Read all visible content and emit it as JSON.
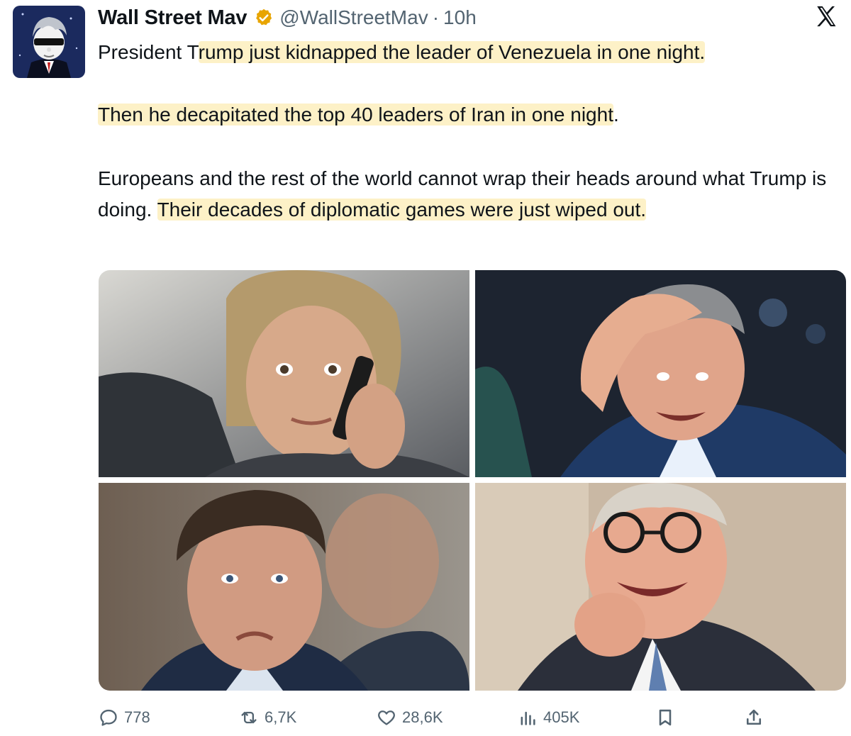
{
  "tweet": {
    "display_name": "Wall Street Mav",
    "handle": "@WallStreetMav",
    "separator": "·",
    "time": "10h",
    "paragraph1": {
      "pre": "President T",
      "highlight": "rump just kidnapped the leader of Venezuela in one night."
    },
    "paragraph2": {
      "highlight": "Then he decapitated the top 40 leaders of Iran in one night",
      "post": "."
    },
    "paragraph3": {
      "pre": "Europeans and the rest of the world cannot wrap their heads around what Trump is doing. ",
      "highlight": "Their decades of diplomatic games were just wiped out."
    },
    "images": [
      {
        "icon": "photo-woman-on-phone"
      },
      {
        "icon": "photo-man-hand-on-forehead"
      },
      {
        "icon": "photo-man-frowning"
      },
      {
        "icon": "photo-man-crying-glasses"
      }
    ]
  },
  "actions": {
    "replies": "778",
    "reposts": "6,7K",
    "likes": "28,6K",
    "views": "405K"
  },
  "colors": {
    "highlight": "#fdf1c7",
    "verified_badge": "#e8a500",
    "muted_text": "#536471",
    "text": "#0f1419"
  }
}
